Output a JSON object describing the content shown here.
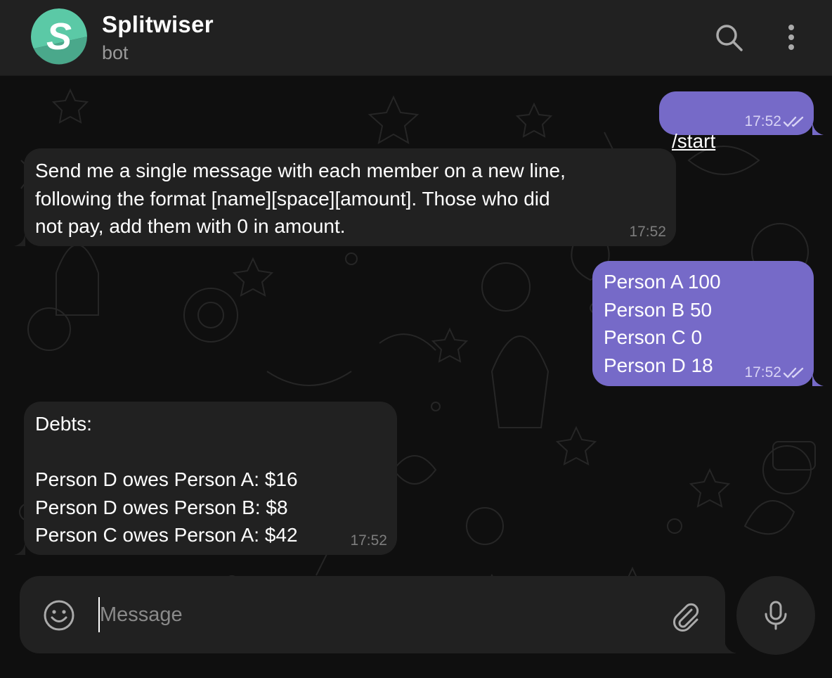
{
  "header": {
    "title": "Splitwiser",
    "subtitle": "bot",
    "avatar_letter": "S",
    "avatar_colors": {
      "primary": "#5bc9a6",
      "accent": "#2f8f73",
      "bg": "#2c2c2e"
    },
    "search_icon": "search-icon",
    "menu_icon": "more-vertical-icon"
  },
  "colors": {
    "header_bg": "#212121",
    "chat_bg": "#0f0f0f",
    "incoming_bubble": "#212121",
    "outgoing_bubble": "#766ac8",
    "meta_text_in": "#7d7d7d",
    "meta_text_out": "#d8d3f5"
  },
  "messages": [
    {
      "direction": "out",
      "text": "/start",
      "is_command": true,
      "time": "17:52",
      "status": "read"
    },
    {
      "direction": "in",
      "text": "Send me a single message with each member on a new line,\nfollowing the format [name][space][amount]. Those who did\nnot pay, add them with 0 in amount.",
      "time": "17:52"
    },
    {
      "direction": "out",
      "text": "Person A 100\nPerson B 50\nPerson C 0\nPerson D 18",
      "time": "17:52",
      "status": "read"
    },
    {
      "direction": "in",
      "text": "Debts:\n\nPerson D owes Person A: $16\nPerson D owes Person B: $8\nPerson C owes Person A: $42",
      "time": "17:52"
    }
  ],
  "composer": {
    "placeholder": "Message",
    "value": "",
    "emoji_icon": "smiley-icon",
    "attach_icon": "paperclip-icon",
    "mic_icon": "microphone-icon"
  }
}
